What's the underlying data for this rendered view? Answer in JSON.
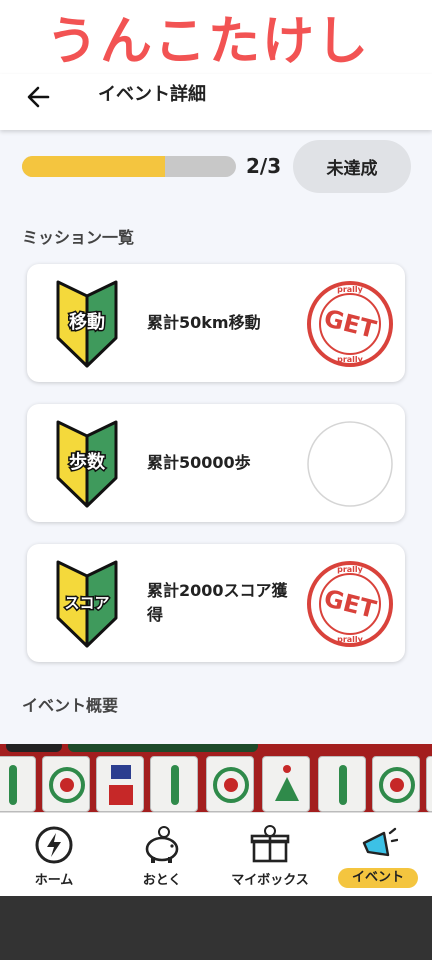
{
  "app": {
    "brand_title": "うんこたけし",
    "brand_color": "#f25353",
    "accent_color": "#f4c53f"
  },
  "header": {
    "title": "イベント詳細",
    "back_icon": "back-arrow-icon"
  },
  "progress": {
    "completed": 2,
    "total": 3,
    "label": "2/3",
    "status_button": "未達成"
  },
  "missions": {
    "section_title": "ミッション一覧",
    "items": [
      {
        "badge_text": "移動",
        "label": "累計50km移動",
        "stamp_done": true,
        "stamp_text": "GET",
        "stamp_brand": "prally"
      },
      {
        "badge_text": "歩数",
        "label": "累計50000歩",
        "stamp_done": false,
        "stamp_text": "",
        "stamp_brand": ""
      },
      {
        "badge_text": "スコア",
        "label": "累計2000スコア獲得",
        "stamp_done": true,
        "stamp_text": "GET",
        "stamp_brand": "prally"
      }
    ]
  },
  "overview": {
    "section_title": "イベント概要"
  },
  "nav": {
    "items": [
      {
        "label": "ホーム",
        "icon": "lightning-icon",
        "active": false
      },
      {
        "label": "おとく",
        "icon": "piggy-bank-icon",
        "active": false
      },
      {
        "label": "マイボックス",
        "icon": "gift-box-icon",
        "active": false
      },
      {
        "label": "イベント",
        "icon": "megaphone-icon",
        "active": true
      }
    ]
  }
}
